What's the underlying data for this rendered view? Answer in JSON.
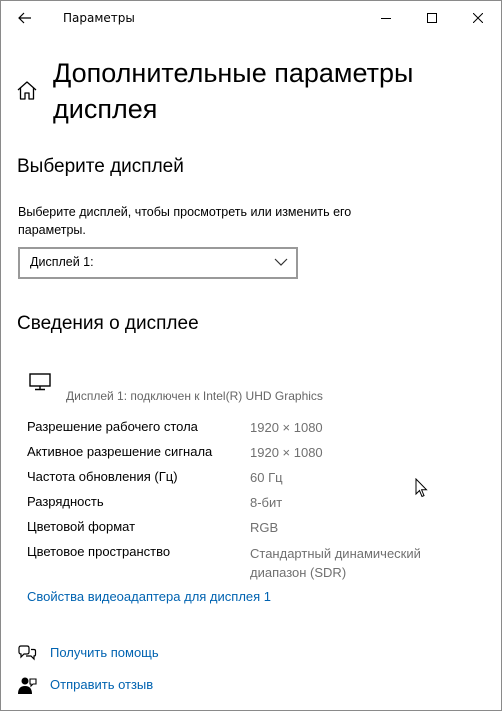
{
  "window": {
    "title": "Параметры",
    "back_icon": "back-arrow-icon",
    "minimize_icon": "minimize-icon",
    "maximize_icon": "maximize-icon",
    "close_icon": "close-icon"
  },
  "header": {
    "home_icon": "home-icon",
    "title": "Дополнительные параметры дисплея"
  },
  "select_display": {
    "heading": "Выберите дисплей",
    "description": "Выберите дисплей, чтобы просмотреть или изменить его параметры.",
    "dropdown_value": "Дисплей 1:"
  },
  "display_info": {
    "heading": "Сведения о дисплее",
    "monitor_icon": "monitor-icon",
    "connected_text": "Дисплей 1: подключен к Intel(R) UHD Graphics",
    "rows": [
      {
        "label": "Разрешение рабочего стола",
        "value": "1920 × 1080"
      },
      {
        "label": "Активное разрешение сигнала",
        "value": "1920 × 1080"
      },
      {
        "label": "Частота обновления (Гц)",
        "value": "60 Гц"
      },
      {
        "label": "Разрядность",
        "value": "8-бит"
      },
      {
        "label": "Цветовой формат",
        "value": "RGB"
      },
      {
        "label": "Цветовое пространство",
        "value": "Стандартный динамический диапазон (SDR)"
      }
    ],
    "adapter_link": "Свойства видеоадаптера для дисплея 1"
  },
  "footer": {
    "help_label": "Получить помощь",
    "help_icon": "help-chat-icon",
    "feedback_label": "Отправить отзыв",
    "feedback_icon": "feedback-person-icon"
  },
  "colors": {
    "link": "#0063b1",
    "secondary_text": "#707070",
    "border": "#999999"
  }
}
